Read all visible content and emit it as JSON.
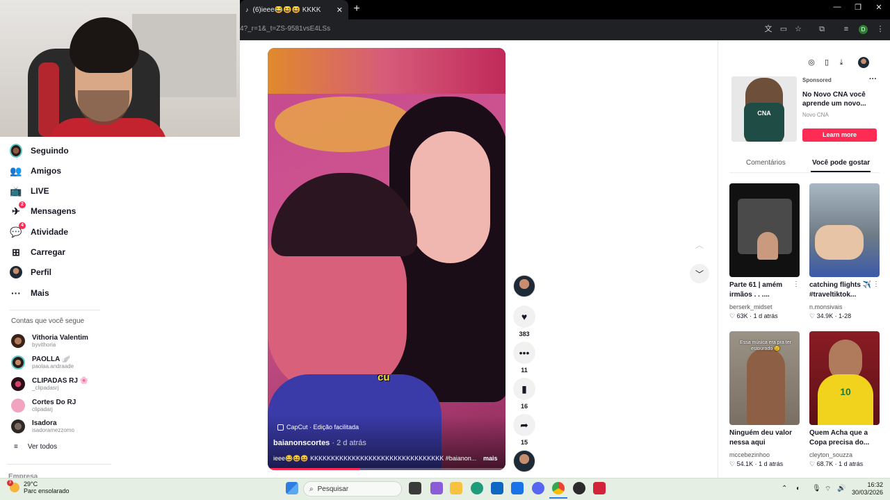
{
  "browser": {
    "tab_title": "(6)ieee😂😆😆 KKKKKKKK",
    "tab_close": "✕",
    "new_tab": "+",
    "url": "4?_r=1&_t=ZS-9581vsE4LSs",
    "profile_initial": "D"
  },
  "nav": {
    "items": [
      {
        "label": "Seguindo",
        "badge": ""
      },
      {
        "label": "Amigos",
        "badge": ""
      },
      {
        "label": "LIVE",
        "badge": ""
      },
      {
        "label": "Mensagens",
        "badge": "2"
      },
      {
        "label": "Atividade",
        "badge": "4"
      },
      {
        "label": "Carregar",
        "badge": ""
      },
      {
        "label": "Perfil",
        "badge": ""
      },
      {
        "label": "Mais",
        "badge": ""
      }
    ]
  },
  "following": {
    "header": "Contas que você segue",
    "accounts": [
      {
        "name": "Vithoria Valentim",
        "handle": "byvithoria"
      },
      {
        "name": "PAOLLA 🪽",
        "handle": "paolaa.andraade"
      },
      {
        "name": "CLIPADAS RJ 🌸",
        "handle": "_clipadasrj"
      },
      {
        "name": "Cortes Do RJ",
        "handle": "clipadarj"
      },
      {
        "name": "Isadora",
        "handle": "isadoramezzomo"
      }
    ],
    "see_all": "Ver todos"
  },
  "footer": {
    "company": "Empresa"
  },
  "video": {
    "caption_word": "cu",
    "capcut_label": "CapCut · Edição facilitada",
    "author": "baianonscortes",
    "posted": " · 2 d atrás",
    "description": "ieee😂😆😆 KKKKKKKKKKKKKKKKKKKKKKKKKKKKKKKK #baianon...",
    "more": "mais",
    "progress": 0.39
  },
  "actions": {
    "likes": "383",
    "comments": "11",
    "saves": "16",
    "shares": "15"
  },
  "ad": {
    "sponsored": "Sponsored",
    "title": "No Novo CNA você aprende um novo...",
    "brand": "Novo CNA",
    "logo_text": "CNA",
    "cta": "Learn more"
  },
  "right_tabs": {
    "comments": "Comentários",
    "recommended": "Você pode gostar"
  },
  "recommendations": [
    {
      "title": "Parte 61 | amém irmãos . . ....",
      "author": "berserk_midset",
      "likes": "63K",
      "date": "1 d atrás"
    },
    {
      "title": "catching flights ✈️ #traveltiktok...",
      "author": "n.monsivais",
      "likes": "34.9K",
      "date": "1-28"
    },
    {
      "title": "Ninguém deu valor nessa aqui",
      "author": "mccebezinhoo",
      "likes": "54.1K",
      "date": "1 d atrás"
    },
    {
      "title": "Quem Acha que a Copa precisa do...",
      "author": "cleyton_souzza",
      "likes": "68.7K",
      "date": "1 d atrás"
    }
  ],
  "card_overlays": {
    "thumb3_text": "Essa música era pra ter estourado 😢"
  },
  "taskbar": {
    "weather_badge": "3",
    "temperature": "29°C",
    "weather_desc": "Parc ensolarado",
    "search_placeholder": "Pesquisar",
    "time": "16:32",
    "date": "30/03/2026"
  }
}
